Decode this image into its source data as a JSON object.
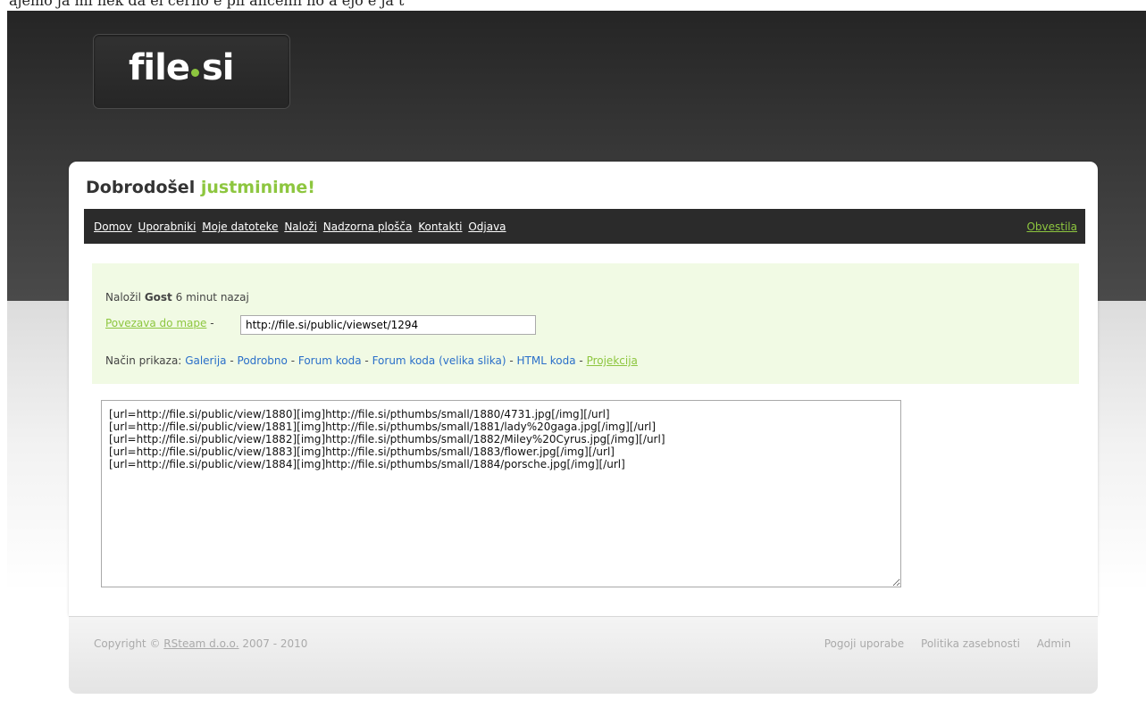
{
  "top_strip_text": "ajemo ja mi nek da el cerno e pii ancenn no a ejo e ja t",
  "logo": {
    "text_left": "file",
    "text_right": "si"
  },
  "welcome": {
    "prefix": "Dobrodošel",
    "username": "justminime!"
  },
  "nav": {
    "items": [
      "Domov",
      "Uporabniki",
      "Moje datoteke",
      "Naloži",
      "Nadzorna plošča",
      "Kontakti",
      "Odjava"
    ],
    "right": "Obvestila"
  },
  "info": {
    "uploaded_prefix": "Naložil",
    "uploader": "Gost",
    "uploaded_suffix": "6 minut nazaj",
    "folder_link_label": "Povezava do mape",
    "separator": "-",
    "folder_url": "http://file.si/public/viewset/1294",
    "view_mode_label": "Način prikaza:",
    "view_modes": [
      "Galerija",
      "Podrobno",
      "Forum koda",
      "Forum koda (velika slika)",
      "HTML koda",
      "Projekcija"
    ]
  },
  "code_text": "[url=http://file.si/public/view/1880][img]http://file.si/pthumbs/small/1880/4731.jpg[/img][/url]\n[url=http://file.si/public/view/1881][img]http://file.si/pthumbs/small/1881/lady%20gaga.jpg[/img][/url]\n[url=http://file.si/public/view/1882][img]http://file.si/pthumbs/small/1882/Miley%20Cyrus.jpg[/img][/url]\n[url=http://file.si/public/view/1883][img]http://file.si/pthumbs/small/1883/flower.jpg[/img][/url]\n[url=http://file.si/public/view/1884][img]http://file.si/pthumbs/small/1884/porsche.jpg[/img][/url]",
  "footer": {
    "copyright_prefix": "Copyright ©",
    "company": "RSteam d.o.o.",
    "years": "2007 - 2010",
    "links": [
      "Pogoji uporabe",
      "Politika zasebnosti",
      "Admin"
    ]
  },
  "colors": {
    "accent_green": "#8dc63f",
    "link_blue": "#2a6fc9",
    "nav_bg": "#2b2b2b"
  }
}
